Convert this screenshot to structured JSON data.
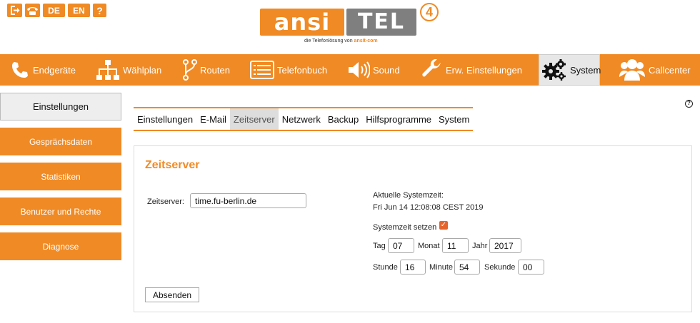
{
  "toolbar": {
    "logout_icon": "logout-icon",
    "phone_icon": "phone-icon",
    "lang_de": "DE",
    "lang_en": "EN",
    "help": "?"
  },
  "logo": {
    "left_text": "ansi",
    "right_text": "TEL",
    "number": "4",
    "tagline_prefix": "die Telefonlösung von ",
    "tagline_brand": "ansit-com"
  },
  "nav": {
    "items": [
      {
        "label": "Endgeräte",
        "icon": "phone-icon"
      },
      {
        "label": "Wählplan",
        "icon": "hierarchy-icon"
      },
      {
        "label": "Routen",
        "icon": "route-icon"
      },
      {
        "label": "Telefonbuch",
        "icon": "list-icon"
      },
      {
        "label": "Sound",
        "icon": "speaker-icon"
      },
      {
        "label": "Erw. Einstellungen",
        "icon": "wrench-icon"
      },
      {
        "label": "System",
        "icon": "gears-icon"
      },
      {
        "label": "Callcenter",
        "icon": "users-icon"
      }
    ]
  },
  "sidebar": {
    "items": [
      {
        "label": "Einstellungen"
      },
      {
        "label": "Gesprächsdaten"
      },
      {
        "label": "Statistiken"
      },
      {
        "label": "Benutzer und Rechte"
      },
      {
        "label": "Diagnose"
      }
    ]
  },
  "subtabs": {
    "items": [
      {
        "label": "Einstellungen"
      },
      {
        "label": "E-Mail"
      },
      {
        "label": "Zeitserver"
      },
      {
        "label": "Netzwerk"
      },
      {
        "label": "Backup"
      },
      {
        "label": "Hilfsprogramme"
      },
      {
        "label": "System"
      }
    ]
  },
  "help_icon": "?",
  "panel": {
    "title": "Zeitserver",
    "zeitserver_label": "Zeitserver:",
    "zeitserver_value": "time.fu-berlin.de",
    "systemzeit_label": "Aktuelle Systemzeit:",
    "systemzeit_value": "Fri Jun 14 12:08:08 CEST 2019",
    "systemzeit_setzen_label": "Systemzeit setzen",
    "systemzeit_setzen_checked": true,
    "tag_label": "Tag",
    "tag_value": "07",
    "monat_label": "Monat",
    "monat_value": "11",
    "jahr_label": "Jahr",
    "jahr_value": "2017",
    "stunde_label": "Stunde",
    "stunde_value": "16",
    "minute_label": "Minute",
    "minute_value": "54",
    "sekunde_label": "Sekunde",
    "sekunde_value": "00",
    "submit_label": "Absenden"
  }
}
